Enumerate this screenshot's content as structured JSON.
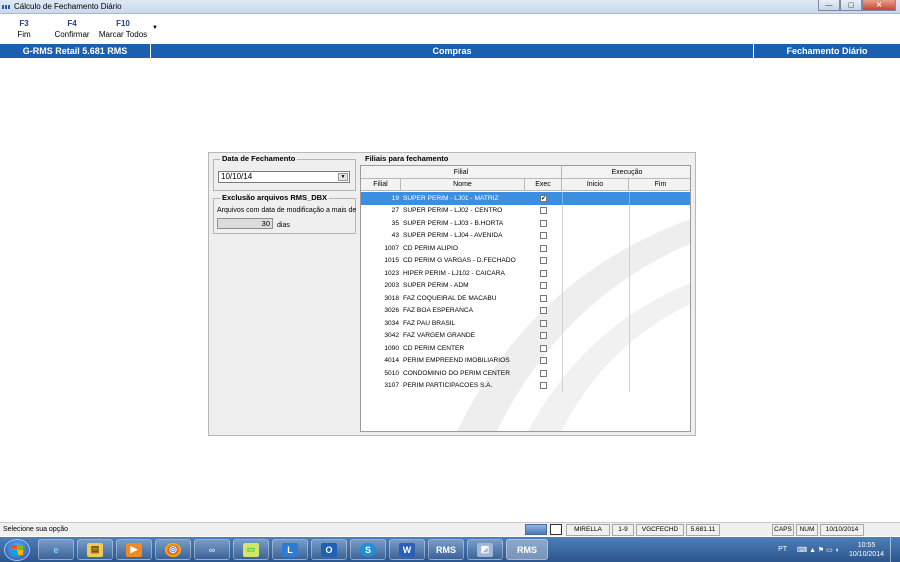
{
  "window": {
    "title": "Cálculo de Fechamento Diário",
    "buttons": {
      "minimize": "—",
      "maximize": "▢",
      "close": "✕"
    }
  },
  "toolbar": {
    "items": [
      {
        "key": "F3",
        "label": "Fim"
      },
      {
        "key": "F4",
        "label": "Confirmar"
      },
      {
        "key": "F10",
        "label": "Marcar Todos"
      }
    ],
    "more": "▼"
  },
  "header": {
    "app": "G-RMS Retail 5.681 RMS",
    "module": "Compras",
    "screen": "Fechamento Diário"
  },
  "left": {
    "date_group": "Data de Fechamento",
    "date_value": "10/10/14",
    "excl_group": "Exclusão arquivos RMS_DBX",
    "excl_text": "Arquivos com data de modificação a mais de",
    "days_value": "30",
    "days_label": "dias"
  },
  "table": {
    "group": "Filiais para fechamento",
    "head_filial": "Filial",
    "head_execucao": "Execução",
    "col_filial": "Filial",
    "col_nome": "Nome",
    "col_exec": "Exec",
    "col_inicio": "Inicio",
    "col_fim": "Fim",
    "rows": [
      {
        "filial": "19",
        "nome": "SUPER PERIM - LJ01 - MATRIZ",
        "checked": true,
        "selected": true
      },
      {
        "filial": "27",
        "nome": "SUPER PERIM - LJ02 - CENTRO",
        "checked": false
      },
      {
        "filial": "35",
        "nome": "SUPER PERIM - LJ03 - B.HORTA",
        "checked": false
      },
      {
        "filial": "43",
        "nome": "SUPER PERIM - LJ04 - AVENIDA",
        "checked": false
      },
      {
        "filial": "1007",
        "nome": "CD PERIM ALIPIO",
        "checked": false
      },
      {
        "filial": "1015",
        "nome": "CD PERIM G VARGAS - D.FECHADO",
        "checked": false
      },
      {
        "filial": "1023",
        "nome": "HIPER PERIM - LJ102 - CAICARA",
        "checked": false
      },
      {
        "filial": "2003",
        "nome": "SUPER PERIM - ADM",
        "checked": false
      },
      {
        "filial": "3018",
        "nome": "FAZ COQUEIRAL DE MACABU",
        "checked": false
      },
      {
        "filial": "3026",
        "nome": "FAZ BOA ESPERANCA",
        "checked": false
      },
      {
        "filial": "3034",
        "nome": "FAZ PAU BRASIL",
        "checked": false
      },
      {
        "filial": "3042",
        "nome": "FAZ VARGEM GRANDE",
        "checked": false
      },
      {
        "filial": "1090",
        "nome": "CD PERIM CENTER",
        "checked": false
      },
      {
        "filial": "4014",
        "nome": "PERIM EMPREEND IMOBILIARIOS",
        "checked": false
      },
      {
        "filial": "5010",
        "nome": "CONDOMINIO DO PERIM CENTER",
        "checked": false
      },
      {
        "filial": "3107",
        "nome": "PERIM PARTICIPACOES S.A.",
        "checked": false
      }
    ]
  },
  "status": {
    "message": "Selecione sua opção",
    "user": "MIRELLA",
    "range": "1-9",
    "program": "VGCFECHD",
    "version": "5.681.11",
    "caps": "CAPS",
    "num": "NUM",
    "date": "10/10/2014"
  },
  "taskbar": {
    "apps": [
      "e",
      "▤",
      "▶",
      "◎",
      "∞",
      "▭",
      "L",
      "O",
      "S",
      "W",
      "RMS",
      "◩",
      "RMS"
    ],
    "tray_lang": "PT",
    "time": "10:55",
    "date": "10/10/2014"
  }
}
